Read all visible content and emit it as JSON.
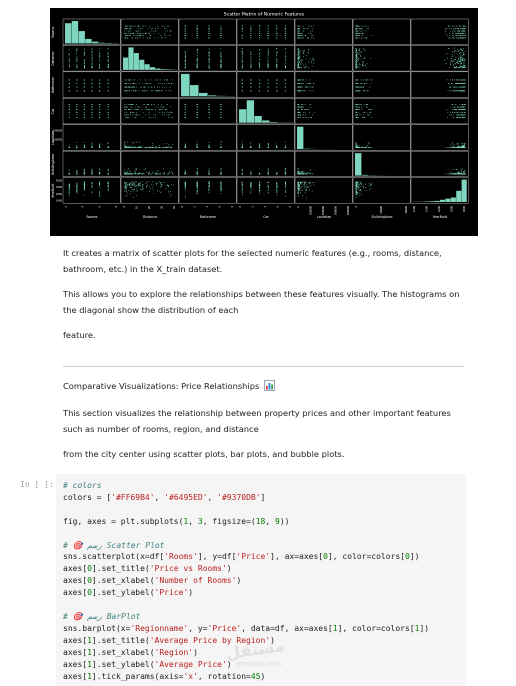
{
  "figure": {
    "title": "Scatter Matrix of Numeric Features",
    "features": [
      "Rooms",
      "Distance",
      "Bathroom",
      "Car",
      "Landsize",
      "BuildingArea",
      "YearBuilt"
    ],
    "marker_color": "#7fd6c0",
    "background": "#000000"
  },
  "chart_data": {
    "type": "scatter",
    "title": "Scatter Matrix of Numeric Features",
    "variables": [
      "Rooms",
      "Distance",
      "Bathroom",
      "Car",
      "Landsize",
      "BuildingArea",
      "YearBuilt"
    ],
    "x_tick_labels": [
      "2",
      "4",
      "6",
      "8",
      "0",
      "10",
      "20",
      "30",
      "40",
      "0",
      "2",
      "4",
      "6",
      "8",
      "0",
      "2",
      "4",
      "6",
      "8",
      "0",
      "100000",
      "200000",
      "300000",
      "400000",
      "0",
      "20000",
      "40000",
      "1200",
      "1400",
      "1600",
      "1800",
      "2000"
    ],
    "y_tick_labels": [
      "200000",
      "100000",
      "2000",
      "1800",
      "1600",
      "1400"
    ],
    "grid": false,
    "diagonal": "histogram"
  },
  "markdown": {
    "p1": "It creates a matrix of scatter plots for the selected numeric features (e.g., rooms, distance, bathroom, etc.) in the X_train dataset.",
    "p2": "This allows you to explore the relationships between these features visually. The histograms on the diagonal show the distribution of each",
    "p3": "feature.",
    "p4": "Comparative Visualizations: Price Relationships",
    "p4_icon": "bar-chart-emoji-icon",
    "p5": "This section visualizes the relationship between property prices and other important features such as number of rooms, region, and distance",
    "p6": "from the city center using scatter plots, bar plots, and bubble plots."
  },
  "cell": {
    "prompt": "In [ ]:",
    "lines": [
      [
        [
          "c",
          "# colors"
        ]
      ],
      [
        [
          "",
          "colors = ["
        ],
        [
          "s",
          "'#FF69B4'"
        ],
        [
          "",
          ", "
        ],
        [
          "s",
          "'#6495ED'"
        ],
        [
          "",
          ", "
        ],
        [
          "s",
          "'#9370DB'"
        ],
        [
          "",
          "]"
        ]
      ],
      [
        [
          "",
          ""
        ]
      ],
      [
        [
          "",
          "fig, axes = plt.subplots("
        ],
        [
          "n",
          "1"
        ],
        [
          "",
          ", "
        ],
        [
          "n",
          "3"
        ],
        [
          "",
          ", figsize=("
        ],
        [
          "n",
          "18"
        ],
        [
          "",
          ", "
        ],
        [
          "n",
          "9"
        ],
        [
          "",
          "))"
        ]
      ],
      [
        [
          "",
          ""
        ]
      ],
      [
        [
          "c",
          "# 🎯 رسم Scatter Plot"
        ]
      ],
      [
        [
          "",
          "sns.scatterplot(x=df["
        ],
        [
          "s",
          "'Rooms'"
        ],
        [
          "",
          "], y=df["
        ],
        [
          "s",
          "'Price'"
        ],
        [
          "",
          "], ax=axes["
        ],
        [
          "n",
          "0"
        ],
        [
          "",
          "], color=colors["
        ],
        [
          "n",
          "0"
        ],
        [
          "",
          "])"
        ]
      ],
      [
        [
          "",
          "axes["
        ],
        [
          "n",
          "0"
        ],
        [
          "",
          "].set_title("
        ],
        [
          "s",
          "'Price vs Rooms'"
        ],
        [
          "",
          ")"
        ]
      ],
      [
        [
          "",
          "axes["
        ],
        [
          "n",
          "0"
        ],
        [
          "",
          "].set_xlabel("
        ],
        [
          "s",
          "'Number of Rooms'"
        ],
        [
          "",
          ")"
        ]
      ],
      [
        [
          "",
          "axes["
        ],
        [
          "n",
          "0"
        ],
        [
          "",
          "].set_ylabel("
        ],
        [
          "s",
          "'Price'"
        ],
        [
          "",
          ")"
        ]
      ],
      [
        [
          "",
          ""
        ]
      ],
      [
        [
          "c",
          "# 🎯 رسم BarPlot"
        ]
      ],
      [
        [
          "",
          "sns.barplot(x="
        ],
        [
          "s",
          "'Regionname'"
        ],
        [
          "",
          ", y="
        ],
        [
          "s",
          "'Price'"
        ],
        [
          "",
          ", data=df, ax=axes["
        ],
        [
          "n",
          "1"
        ],
        [
          "",
          "], color=colors["
        ],
        [
          "n",
          "1"
        ],
        [
          "",
          "])"
        ]
      ],
      [
        [
          "",
          "axes["
        ],
        [
          "n",
          "1"
        ],
        [
          "",
          "].set_title("
        ],
        [
          "s",
          "'Average Price by Region'"
        ],
        [
          "",
          ")"
        ]
      ],
      [
        [
          "",
          "axes["
        ],
        [
          "n",
          "1"
        ],
        [
          "",
          "].set_xlabel("
        ],
        [
          "s",
          "'Region'"
        ],
        [
          "",
          ")"
        ]
      ],
      [
        [
          "",
          "axes["
        ],
        [
          "n",
          "1"
        ],
        [
          "",
          "].set_ylabel("
        ],
        [
          "s",
          "'Average Price'"
        ],
        [
          "",
          ")"
        ]
      ],
      [
        [
          "",
          "axes["
        ],
        [
          "n",
          "1"
        ],
        [
          "",
          "].tick_params(axis="
        ],
        [
          "s",
          "'x'"
        ],
        [
          "",
          ", rotation="
        ],
        [
          "n",
          "45"
        ],
        [
          "",
          ")"
        ]
      ]
    ]
  },
  "watermark": {
    "text": "مستقل",
    "sub": "mostaql.com"
  }
}
